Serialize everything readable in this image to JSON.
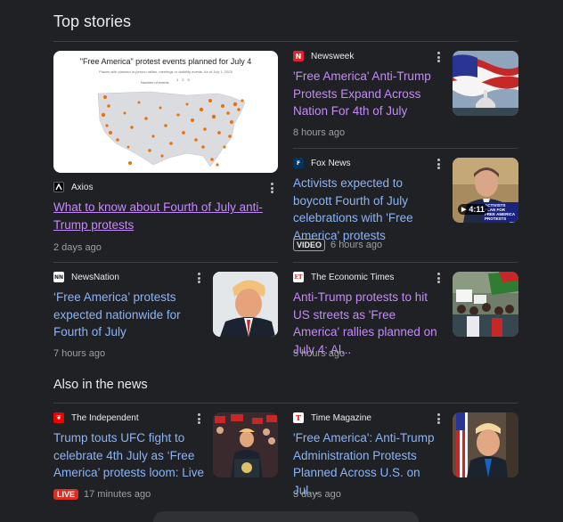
{
  "sections": {
    "top_stories": "Top stories",
    "also_in_news": "Also in the news"
  },
  "featured": {
    "map_title": "\"Free America\" protest events planned for July 4",
    "map_subtitle": "Places with planned in-person rallies, meetings or visibility events. As of July 1, 2025",
    "legend_label": "Number of events",
    "legend_values": [
      "1",
      "2",
      "5"
    ],
    "source": "Axios",
    "title": "What to know about Fourth of July anti-Trump protests",
    "time": "2 days ago"
  },
  "stories": [
    {
      "source": "Newsweek",
      "title": "'Free America' Anti-Trump Protests Expand Across Nation For 4th of July",
      "time": "8 hours ago"
    },
    {
      "source": "Fox News",
      "title": "Activists expected to boycott Fourth of July celebrations with 'Free America' protests",
      "time": "6 hours ago",
      "badge": "VIDEO",
      "duration": "4:11",
      "overlay_text": "ACTIVISTS PLAN FOR FREE AMERICA PROTESTS"
    },
    {
      "source": "NewsNation",
      "title": "‘Free America’ protests expected nationwide for Fourth of July",
      "time": "7 hours ago"
    },
    {
      "source": "The Economic Times",
      "title": "Anti-Trump protests to hit US streets as 'Free America' rallies planned on July 4: Al...",
      "time": "5 hours ago"
    }
  ],
  "also": [
    {
      "source": "The Independent",
      "title": "Trump touts UFC fight to celebrate 4th July as ‘Free America’ protests loom: Live",
      "time": "17 minutes ago",
      "badge": "LIVE"
    },
    {
      "source": "Time Magazine",
      "title": "'Free America': Anti-Trump Administration Protests Planned Across U.S. on Jul...",
      "time": "3 days ago"
    }
  ],
  "colors": {
    "link": "#8ab4f8",
    "visited": "#c58af9",
    "bg": "#202124",
    "meta": "#9aa0a6"
  }
}
